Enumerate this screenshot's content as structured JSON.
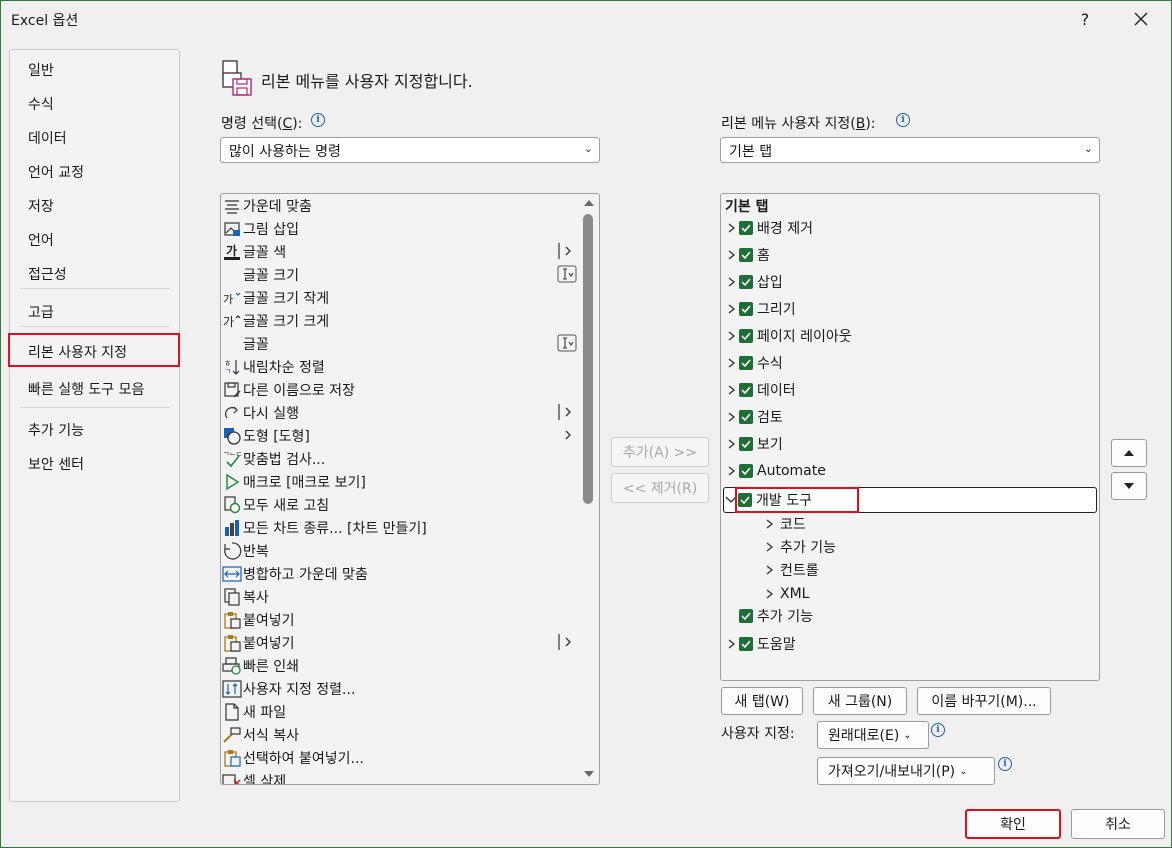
{
  "window": {
    "title": "Excel 옵션",
    "help": "?",
    "close": "✕"
  },
  "nav": {
    "items": [
      "일반",
      "수식",
      "데이터",
      "언어 교정",
      "저장",
      "언어",
      "접근성",
      "고급",
      "리본 사용자 지정",
      "빠른 실행 도구 모음",
      "추가 기능",
      "보안 센터"
    ],
    "selected": "리본 사용자 지정"
  },
  "heading": "리본 메뉴를 사용자 지정합니다.",
  "left": {
    "label_pre": "명령 선택(",
    "label_key": "C",
    "label_post": "):",
    "combo_value": "많이 사용하는 명령",
    "commands": [
      {
        "label": "가운데 맞춤",
        "icon": "align-center-icon",
        "sub": ""
      },
      {
        "label": "그림 삽입",
        "icon": "picture-icon",
        "sub": ""
      },
      {
        "label": "글꼴 색",
        "icon": "font-color-icon",
        "sub": "|>"
      },
      {
        "label": "글꼴 크기",
        "icon": "",
        "sub": "I"
      },
      {
        "label": "글꼴 크기 작게",
        "icon": "font-shrink-icon",
        "sub": ""
      },
      {
        "label": "글꼴 크기 크게",
        "icon": "font-grow-icon",
        "sub": ""
      },
      {
        "label": "글꼴",
        "icon": "",
        "sub": "I"
      },
      {
        "label": "내림차순 정렬",
        "icon": "sort-desc-icon",
        "sub": ""
      },
      {
        "label": "다른 이름으로 저장",
        "icon": "save-as-icon",
        "sub": ""
      },
      {
        "label": "다시 실행",
        "icon": "redo-icon",
        "sub": "|>"
      },
      {
        "label": "도형 [도형]",
        "icon": "shapes-icon",
        "sub": ">"
      },
      {
        "label": "맞춤법 검사...",
        "icon": "spelling-icon",
        "sub": ""
      },
      {
        "label": "매크로 [매크로 보기]",
        "icon": "macro-icon",
        "sub": ""
      },
      {
        "label": "모두 새로 고침",
        "icon": "refresh-all-icon",
        "sub": ""
      },
      {
        "label": "모든 차트 종류... [차트 만들기]",
        "icon": "chart-icon",
        "sub": ""
      },
      {
        "label": "반복",
        "icon": "repeat-icon",
        "sub": ""
      },
      {
        "label": "병합하고 가운데 맞춤",
        "icon": "merge-center-icon",
        "sub": ""
      },
      {
        "label": "복사",
        "icon": "copy-icon",
        "sub": ""
      },
      {
        "label": "붙여넣기",
        "icon": "paste-icon",
        "sub": ""
      },
      {
        "label": "붙여넣기",
        "icon": "paste-icon",
        "sub": "|>"
      },
      {
        "label": "빠른 인쇄",
        "icon": "quick-print-icon",
        "sub": ""
      },
      {
        "label": "사용자 지정 정렬...",
        "icon": "custom-sort-icon",
        "sub": ""
      },
      {
        "label": "새 파일",
        "icon": "new-file-icon",
        "sub": ""
      },
      {
        "label": "서식 복사",
        "icon": "format-painter-icon",
        "sub": ""
      },
      {
        "label": "선택하여 붙여넣기...",
        "icon": "paste-special-icon",
        "sub": ""
      },
      {
        "label": "셀 삭제...",
        "icon": "delete-cells-icon",
        "sub": ""
      }
    ]
  },
  "middle": {
    "add": "추가(A) >>",
    "remove": "<< 제거(R)"
  },
  "right": {
    "label_pre": "리본 메뉴 사용자 지정(",
    "label_key": "B",
    "label_post": "):",
    "combo_value": "기본 탭",
    "tree_header": "기본 탭",
    "tabs": [
      {
        "label": "배경 제거",
        "level": 0,
        "expand": ">",
        "checked": true
      },
      {
        "label": "홈",
        "level": 0,
        "expand": ">",
        "checked": true
      },
      {
        "label": "삽입",
        "level": 0,
        "expand": ">",
        "checked": true
      },
      {
        "label": "그리기",
        "level": 0,
        "expand": ">",
        "checked": true
      },
      {
        "label": "페이지 레이아웃",
        "level": 0,
        "expand": ">",
        "checked": true
      },
      {
        "label": "수식",
        "level": 0,
        "expand": ">",
        "checked": true
      },
      {
        "label": "데이터",
        "level": 0,
        "expand": ">",
        "checked": true
      },
      {
        "label": "검토",
        "level": 0,
        "expand": ">",
        "checked": true
      },
      {
        "label": "보기",
        "level": 0,
        "expand": ">",
        "checked": true
      },
      {
        "label": "Automate",
        "level": 0,
        "expand": ">",
        "checked": true
      },
      {
        "label": "개발 도구",
        "level": 0,
        "expand": "v",
        "checked": true
      },
      {
        "label": "코드",
        "level": 1,
        "expand": ">",
        "checked": false
      },
      {
        "label": "추가 기능",
        "level": 1,
        "expand": ">",
        "checked": false
      },
      {
        "label": "컨트롤",
        "level": 1,
        "expand": ">",
        "checked": false
      },
      {
        "label": "XML",
        "level": 1,
        "expand": ">",
        "checked": false
      },
      {
        "label": "추가 기능",
        "level": 0,
        "expand": "",
        "checked": true
      },
      {
        "label": "도움말",
        "level": 0,
        "expand": ">",
        "checked": true
      }
    ],
    "new_tab": "새 탭(W)",
    "new_group": "새 그룹(N)",
    "rename": "이름 바꾸기(M)...",
    "customize_label": "사용자 지정:",
    "reset": "원래대로(E)",
    "import_export": "가져오기/내보내기(P)"
  },
  "footer": {
    "ok": "확인",
    "cancel": "취소"
  },
  "colors": {
    "checkbox": "#1e6f33",
    "highlight": "#e3101a",
    "info": "#1763b8"
  }
}
